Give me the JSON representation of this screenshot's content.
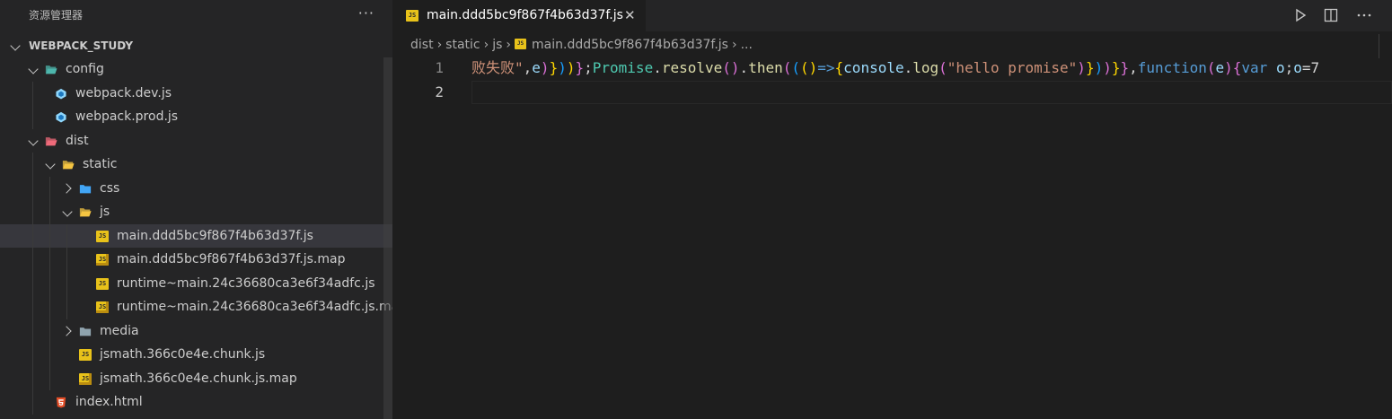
{
  "sidebar": {
    "title": "资源管理器",
    "more_actions": "···",
    "tree": [
      {
        "label": "WEBPACK_STUDY",
        "depth": 0,
        "kind": "root",
        "expanded": true
      },
      {
        "label": "config",
        "depth": 1,
        "kind": "folder-config",
        "expanded": true
      },
      {
        "label": "webpack.dev.js",
        "depth": 2,
        "kind": "webpack"
      },
      {
        "label": "webpack.prod.js",
        "depth": 2,
        "kind": "webpack"
      },
      {
        "label": "dist",
        "depth": 1,
        "kind": "folder-dist",
        "expanded": true
      },
      {
        "label": "static",
        "depth": 2,
        "kind": "folder-open",
        "expanded": true
      },
      {
        "label": "css",
        "depth": 3,
        "kind": "folder-css",
        "expanded": false
      },
      {
        "label": "js",
        "depth": 3,
        "kind": "folder-js-open",
        "expanded": true
      },
      {
        "label": "main.ddd5bc9f867f4b63d37f.js",
        "depth": 4,
        "kind": "js",
        "selected": true
      },
      {
        "label": "main.ddd5bc9f867f4b63d37f.js.map",
        "depth": 4,
        "kind": "map"
      },
      {
        "label": "runtime~main.24c36680ca3e6f34adfc.js",
        "depth": 4,
        "kind": "js"
      },
      {
        "label": "runtime~main.24c36680ca3e6f34adfc.js.map",
        "depth": 4,
        "kind": "map"
      },
      {
        "label": "media",
        "depth": 3,
        "kind": "folder",
        "expanded": false
      },
      {
        "label": "jsmath.366c0e4e.chunk.js",
        "depth": 3,
        "kind": "js"
      },
      {
        "label": "jsmath.366c0e4e.chunk.js.map",
        "depth": 3,
        "kind": "map"
      },
      {
        "label": "index.html",
        "depth": 2,
        "kind": "html"
      }
    ]
  },
  "tab": {
    "label": "main.ddd5bc9f867f4b63d37f.js",
    "close": "✕"
  },
  "breadcrumb": {
    "parts": [
      "dist",
      "static",
      "js",
      "main.ddd5bc9f867f4b63d37f.js",
      "..."
    ],
    "sep": "›"
  },
  "editor": {
    "line_numbers": [
      "1",
      "2"
    ],
    "line1_tokens": [
      {
        "t": "败失败\"",
        "c": "t-str"
      },
      {
        "t": ",",
        "c": "t-pun"
      },
      {
        "t": "e",
        "c": "t-var"
      },
      {
        "t": ")",
        "c": "t-b2"
      },
      {
        "t": "}",
        "c": "t-b1"
      },
      {
        "t": ")",
        "c": "t-b3"
      },
      {
        "t": ")",
        "c": "t-b1"
      },
      {
        "t": "}",
        "c": "t-b2"
      },
      {
        "t": ";",
        "c": "t-pun"
      },
      {
        "t": "Promise",
        "c": "t-cls"
      },
      {
        "t": ".",
        "c": "t-pun"
      },
      {
        "t": "resolve",
        "c": "t-fn"
      },
      {
        "t": "()",
        "c": "t-b2"
      },
      {
        "t": ".",
        "c": "t-pun"
      },
      {
        "t": "then",
        "c": "t-fn"
      },
      {
        "t": "(",
        "c": "t-b2"
      },
      {
        "t": "(",
        "c": "t-b3"
      },
      {
        "t": "()",
        "c": "t-b1"
      },
      {
        "t": "=>",
        "c": "t-kw"
      },
      {
        "t": "{",
        "c": "t-b1"
      },
      {
        "t": "console",
        "c": "t-var"
      },
      {
        "t": ".",
        "c": "t-pun"
      },
      {
        "t": "log",
        "c": "t-fn"
      },
      {
        "t": "(",
        "c": "t-b2"
      },
      {
        "t": "\"hello promise\"",
        "c": "t-str"
      },
      {
        "t": ")",
        "c": "t-b2"
      },
      {
        "t": "}",
        "c": "t-b1"
      },
      {
        "t": ")",
        "c": "t-b3"
      },
      {
        "t": ")",
        "c": "t-b2"
      },
      {
        "t": "}",
        "c": "t-b1"
      },
      {
        "t": "}",
        "c": "t-b2"
      },
      {
        "t": ",",
        "c": "t-pun"
      },
      {
        "t": "function",
        "c": "t-kw"
      },
      {
        "t": "(",
        "c": "t-b2"
      },
      {
        "t": "e",
        "c": "t-var"
      },
      {
        "t": ")",
        "c": "t-b2"
      },
      {
        "t": "{",
        "c": "t-b2"
      },
      {
        "t": "var",
        "c": "t-kw"
      },
      {
        "t": " ",
        "c": "t-pun"
      },
      {
        "t": "o",
        "c": "t-var"
      },
      {
        "t": ";",
        "c": "t-pun"
      },
      {
        "t": "o",
        "c": "t-var"
      },
      {
        "t": "=",
        "c": "t-pun"
      },
      {
        "t": "7",
        "c": "t-pun"
      }
    ]
  },
  "colors": {
    "sidebar_bg": "#252526",
    "editor_bg": "#1e1e1e",
    "selected_row": "#37373d",
    "js_icon": "#e8c21a"
  }
}
